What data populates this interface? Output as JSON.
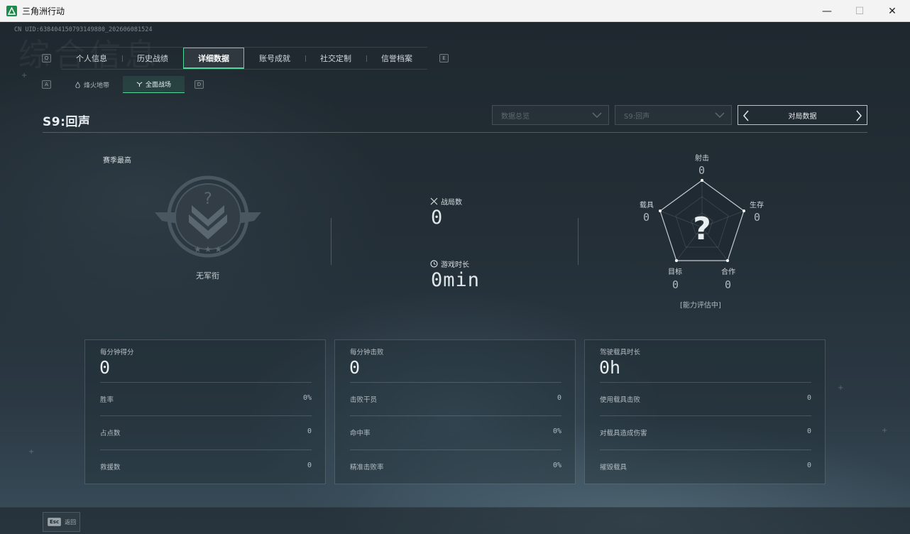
{
  "window": {
    "title": "三角洲行动",
    "minimize": "—",
    "maximize": "☐",
    "close": "✕"
  },
  "header": {
    "uid": "CN UID:6384041507931498​80_202606081524",
    "bg_ghost": "综合信息",
    "key_left": "Q",
    "key_right": "E",
    "sub_key_left": "A",
    "sub_key_right": "D"
  },
  "tabs": [
    {
      "label": "个人信息",
      "active": false
    },
    {
      "label": "历史战绩",
      "active": false
    },
    {
      "label": "详细数据",
      "active": true
    },
    {
      "label": "账号成就",
      "active": false
    },
    {
      "label": "社交定制",
      "active": false
    },
    {
      "label": "信誉档案",
      "active": false
    }
  ],
  "subtabs": [
    {
      "label": "烽火地带",
      "icon": "flame-icon",
      "active": false
    },
    {
      "label": "全面战场",
      "icon": "crosshair-icon",
      "active": true
    }
  ],
  "season": {
    "title": "S9:回声",
    "filter_overview": "数据总览",
    "filter_season": "S9:回声",
    "match_nav_label": "对局数据"
  },
  "rank": {
    "heading": "赛季最高",
    "name": "无军衔",
    "symbol": "?"
  },
  "summary": {
    "matches_label": "战局数",
    "matches_value": "0",
    "time_label": "游戏时长",
    "time_value": "0min"
  },
  "radar": {
    "status": "[能力评估中]",
    "center": "?",
    "axes": [
      {
        "label": "射击",
        "value": "0"
      },
      {
        "label": "生存",
        "value": "0"
      },
      {
        "label": "合作",
        "value": "0"
      },
      {
        "label": "目标",
        "value": "0"
      },
      {
        "label": "载具",
        "value": "0"
      }
    ]
  },
  "panels": [
    {
      "title": "每分钟得分",
      "value": "0",
      "rows": [
        {
          "label": "胜率",
          "value": "0%"
        },
        {
          "label": "占点数",
          "value": "0"
        },
        {
          "label": "救援数",
          "value": "0"
        }
      ]
    },
    {
      "title": "每分钟击败",
      "value": "0",
      "rows": [
        {
          "label": "击败干员",
          "value": "0"
        },
        {
          "label": "命中率",
          "value": "0%"
        },
        {
          "label": "精准击败率",
          "value": "0%"
        }
      ]
    },
    {
      "title": "驾驶载具时长",
      "value": "0h",
      "rows": [
        {
          "label": "使用载具击败",
          "value": "0"
        },
        {
          "label": "对载具造成伤害",
          "value": "0"
        },
        {
          "label": "摧毁载具",
          "value": "0"
        }
      ]
    }
  ],
  "footer": {
    "esc_key": "Esc",
    "back_label": "返回"
  }
}
